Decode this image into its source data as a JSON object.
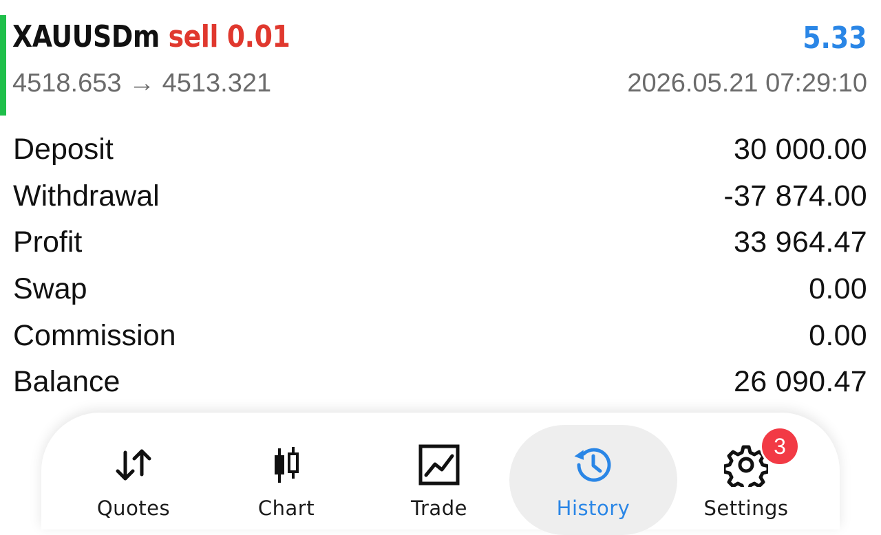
{
  "trade": {
    "symbol": "XAUUSDm",
    "type_label": "sell 0.01",
    "profit": "5.33",
    "price_change": "4518.653 → 4513.321",
    "time": "2026.05.21 07:29:10",
    "colors": {
      "indicator": "#1fbf4a",
      "type": "#e0382e",
      "profit": "#2a86e6"
    }
  },
  "summary": [
    {
      "label": "Deposit",
      "value": "30 000.00"
    },
    {
      "label": "Withdrawal",
      "value": "-37 874.00"
    },
    {
      "label": "Profit",
      "value": "33 964.47"
    },
    {
      "label": "Swap",
      "value": "0.00"
    },
    {
      "label": "Commission",
      "value": "0.00"
    },
    {
      "label": "Balance",
      "value": "26 090.47"
    }
  ],
  "tabbar": {
    "active": "History",
    "tabs": [
      {
        "label": "Quotes",
        "icon": "quotes-arrows-icon"
      },
      {
        "label": "Chart",
        "icon": "candlestick-chart-icon"
      },
      {
        "label": "Trade",
        "icon": "trade-chart-icon"
      },
      {
        "label": "History",
        "icon": "history-clock-icon"
      },
      {
        "label": "Settings",
        "icon": "gear-icon"
      }
    ],
    "settings_badge": "3",
    "colors": {
      "active": "#2a86e6",
      "badge": "#f23a45"
    }
  }
}
